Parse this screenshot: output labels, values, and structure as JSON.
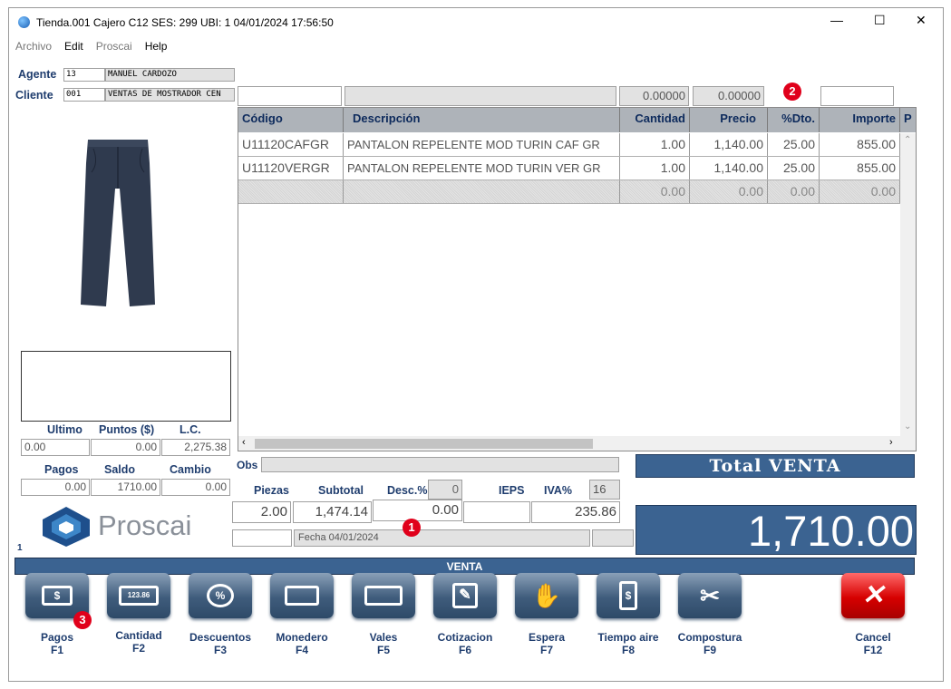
{
  "window": {
    "title": "Tienda.001  Cajero C12     SES: 299   UBI: 1   04/01/2024 17:56:50",
    "minimize": "—",
    "maximize": "☐",
    "close": "✕"
  },
  "menu": [
    "Archivo",
    "Edit",
    "Proscai",
    "Help"
  ],
  "agent": {
    "label": "Agente",
    "code": "13",
    "name": "MANUEL CARDOZO"
  },
  "client": {
    "label": "Cliente",
    "code": "001",
    "name": "VENTAS DE MOSTRADOR CEN"
  },
  "toprow": {
    "field1": "",
    "field2": "",
    "num1": "0.00000",
    "num2": "0.00000",
    "field3": ""
  },
  "grid": {
    "headers": [
      "Código",
      "Descripción",
      "Cantidad",
      "Precio",
      "%Dto.",
      "Importe",
      "P"
    ],
    "rows": [
      [
        "U11120CAFGR",
        "PANTALON REPELENTE MOD TURIN CAF GR",
        "1.00",
        "1,140.00",
        "25.00",
        "855.00"
      ],
      [
        "U11120VERGR",
        "PANTALON REPELENTE MOD TURIN VER GR",
        "1.00",
        "1,140.00",
        "25.00",
        "855.00"
      ],
      [
        "",
        "",
        "0.00",
        "0.00",
        "0.00",
        "0.00"
      ]
    ]
  },
  "points": {
    "headers": [
      "Ultimo",
      "Puntos ($)",
      "L.C."
    ],
    "values": [
      "0.00",
      "0.00",
      "2,275.38"
    ]
  },
  "payments": {
    "headers": [
      "Pagos",
      "Saldo",
      "Cambio"
    ],
    "values": [
      "0.00",
      "1710.00",
      "0.00"
    ]
  },
  "logo": {
    "text": "Proscai"
  },
  "footer_number": "1",
  "obs": {
    "label": "Obs",
    "value": ""
  },
  "totals": {
    "labels": {
      "piezas": "Piezas",
      "subtotal": "Subtotal",
      "desc": "Desc.%",
      "ieps": "IEPS",
      "iva": "IVA%"
    },
    "desc_pct": "0",
    "iva_pct": "16",
    "piezas": "2.00",
    "subtotal": "1,474.14",
    "desc": "0.00",
    "ieps": "",
    "iva": "235.86",
    "fecha": "Fecha 04/01/2024"
  },
  "total_venta": {
    "label": "Total VENTA",
    "value": "1,710.00"
  },
  "status_bar": "VENTA",
  "badges": [
    "1",
    "2",
    "3"
  ],
  "buttons": [
    {
      "name": "Pagos",
      "key": "F1",
      "icon": "$"
    },
    {
      "name": "Cantidad",
      "key": "F2",
      "icon": "123.86"
    },
    {
      "name": "Descuentos",
      "key": "F3",
      "icon": "%"
    },
    {
      "name": "Monedero",
      "key": "F4",
      "icon": ""
    },
    {
      "name": "Vales",
      "key": "F5",
      "icon": ""
    },
    {
      "name": "Cotizacion",
      "key": "F6",
      "icon": "✎"
    },
    {
      "name": "Espera",
      "key": "F7",
      "icon": "✋"
    },
    {
      "name": "Tiempo aire",
      "key": "F8",
      "icon": "$"
    },
    {
      "name": "Compostura",
      "key": "F9",
      "icon": "✂"
    },
    {
      "name": "Cancel",
      "key": "F12",
      "icon": "✕"
    }
  ],
  "colors": {
    "accent": "#3b6391",
    "danger": "#e0001b",
    "label": "#1f3d6e"
  }
}
